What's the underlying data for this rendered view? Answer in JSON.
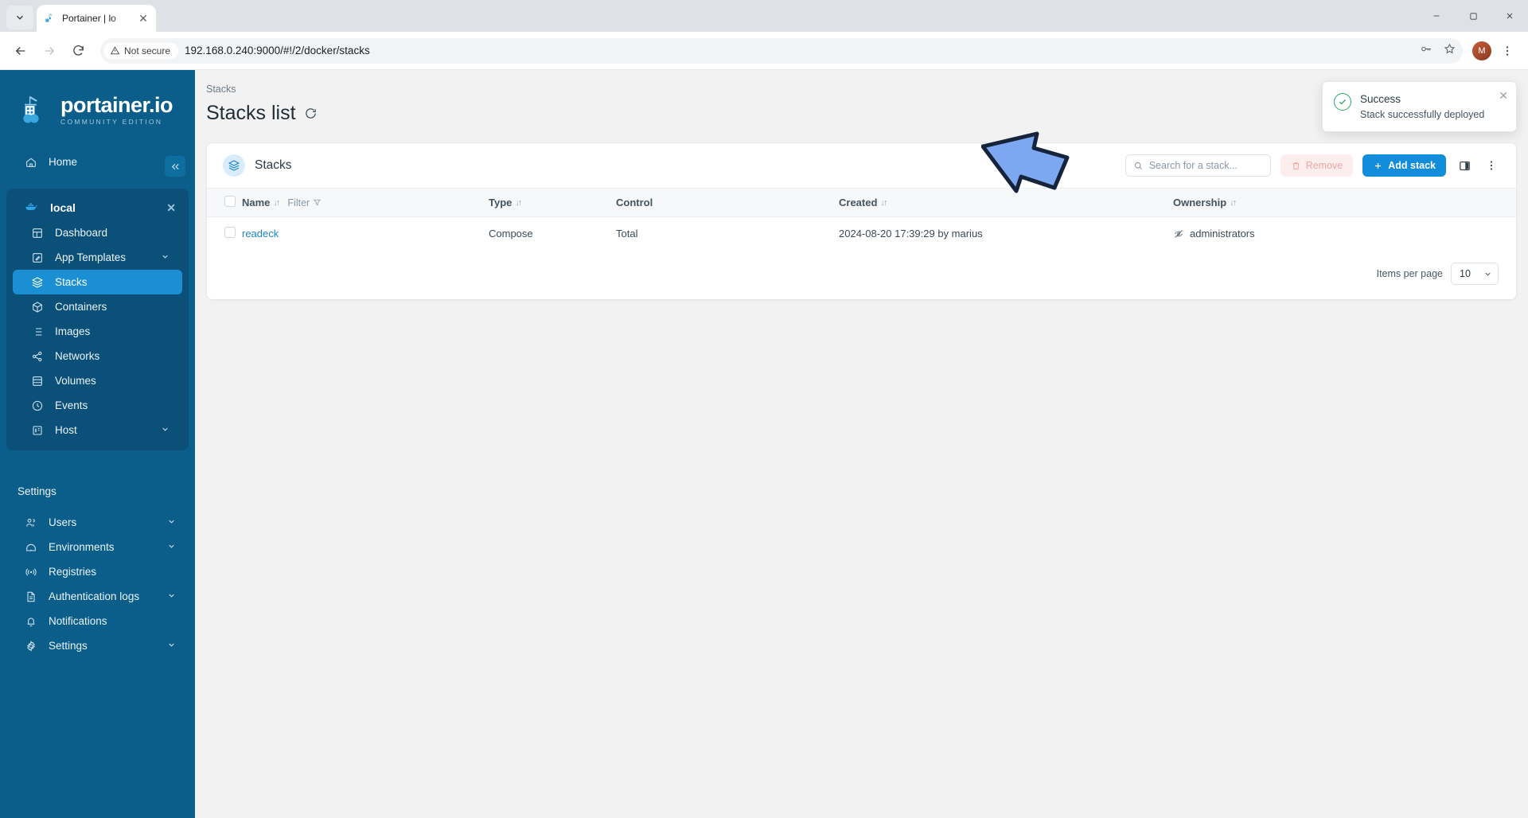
{
  "browser": {
    "tab": {
      "title": "Portainer | lo",
      "favicon_icon": "portainer-favicon",
      "close_icon": "close-icon"
    },
    "tab_list_icon": "chevron-down-icon",
    "window": {
      "minimize_icon": "minimize-icon",
      "maximize_icon": "maximize-icon",
      "close_icon": "close-icon"
    },
    "nav": {
      "back_icon": "arrow-left-icon",
      "forward_icon": "arrow-right-icon",
      "reload_icon": "reload-icon"
    },
    "omnibox": {
      "security_label": "Not secure",
      "security_icon": "warning-triangle-icon",
      "url": "192.168.0.240:9000/#!/2/docker/stacks",
      "password_icon": "key-icon",
      "bookmark_icon": "star-icon"
    },
    "profile_initial": "M",
    "menu_icon": "kebab-menu-icon"
  },
  "sidebar": {
    "logo": {
      "name": "portainer.io",
      "subtitle": "COMMUNITY EDITION",
      "icon": "portainer-crane-logo"
    },
    "collapse_icon": "chevrons-left-icon",
    "home": {
      "label": "Home",
      "icon": "home-icon"
    },
    "environment": {
      "name": "local",
      "icon": "docker-whale-icon",
      "close_icon": "close-icon",
      "items": [
        {
          "label": "Dashboard",
          "icon": "dashboard-icon",
          "active": false,
          "chevron": ""
        },
        {
          "label": "App Templates",
          "icon": "template-pencil-icon",
          "active": false,
          "chevron": "chevron-down-icon"
        },
        {
          "label": "Stacks",
          "icon": "layers-icon",
          "active": true,
          "chevron": ""
        },
        {
          "label": "Containers",
          "icon": "box-icon",
          "active": false,
          "chevron": ""
        },
        {
          "label": "Images",
          "icon": "list-icon",
          "active": false,
          "chevron": ""
        },
        {
          "label": "Networks",
          "icon": "share-nodes-icon",
          "active": false,
          "chevron": ""
        },
        {
          "label": "Volumes",
          "icon": "database-icon",
          "active": false,
          "chevron": ""
        },
        {
          "label": "Events",
          "icon": "clock-icon",
          "active": false,
          "chevron": ""
        },
        {
          "label": "Host",
          "icon": "server-icon",
          "active": false,
          "chevron": "chevron-down-icon"
        }
      ]
    },
    "settings_label": "Settings",
    "settings_items": [
      {
        "label": "Users",
        "icon": "users-icon",
        "chevron": "chevron-down-icon"
      },
      {
        "label": "Environments",
        "icon": "environments-icon",
        "chevron": "chevron-down-icon"
      },
      {
        "label": "Registries",
        "icon": "registries-icon",
        "chevron": ""
      },
      {
        "label": "Authentication logs",
        "icon": "document-icon",
        "chevron": "chevron-down-icon"
      },
      {
        "label": "Notifications",
        "icon": "bell-icon",
        "chevron": ""
      },
      {
        "label": "Settings",
        "icon": "gear-icon",
        "chevron": "chevron-down-icon"
      }
    ]
  },
  "page": {
    "breadcrumb": "Stacks",
    "title": "Stacks list",
    "refresh_icon": "refresh-icon"
  },
  "card": {
    "title": "Stacks",
    "icon": "layers-icon",
    "search_placeholder": "Search for a stack...",
    "search_value": "",
    "search_icon": "search-icon",
    "remove_label": "Remove",
    "remove_icon": "trash-icon",
    "add_label": "Add stack",
    "add_icon": "plus-icon",
    "columns_icon": "columns-layout-icon",
    "more_icon": "kebab-menu-icon"
  },
  "table": {
    "select_all_checkbox": "",
    "columns": [
      {
        "label": "Name",
        "sort": "sort-desc-asc-icon"
      },
      {
        "label": "Type",
        "sort": "sort-desc-asc-icon"
      },
      {
        "label": "Control",
        "sort": ""
      },
      {
        "label": "Created",
        "sort": "sort-desc-asc-icon"
      },
      {
        "label": "Ownership",
        "sort": "sort-desc-asc-icon"
      }
    ],
    "filter_label": "Filter",
    "filter_icon": "funnel-icon",
    "rows": [
      {
        "name": "readeck",
        "type": "Compose",
        "control": "Total",
        "created": "2024-08-20 17:39:29 by marius",
        "ownership": "administrators",
        "ownership_icon": "eye-off-icon"
      }
    ]
  },
  "footer": {
    "items_per_page_label": "Items per page",
    "items_per_page_value": "10",
    "chevron_icon": "chevron-down-icon"
  },
  "toast": {
    "title": "Success",
    "message": "Stack successfully deployed",
    "check_icon": "check-circle-icon",
    "close_icon": "close-icon"
  },
  "annotation": {
    "arrow_icon": "pointer-arrow-icon",
    "arrow_color": "#7da7f0",
    "arrow_outline": "#15243b"
  },
  "colors": {
    "sidebar_bg": "#0b5e8a",
    "sidebar_env_bg": "#0a5078",
    "accent": "#128ddb",
    "active_nav": "#1b8fd4",
    "success": "#2aa96a",
    "danger": "#f0a6a6"
  }
}
